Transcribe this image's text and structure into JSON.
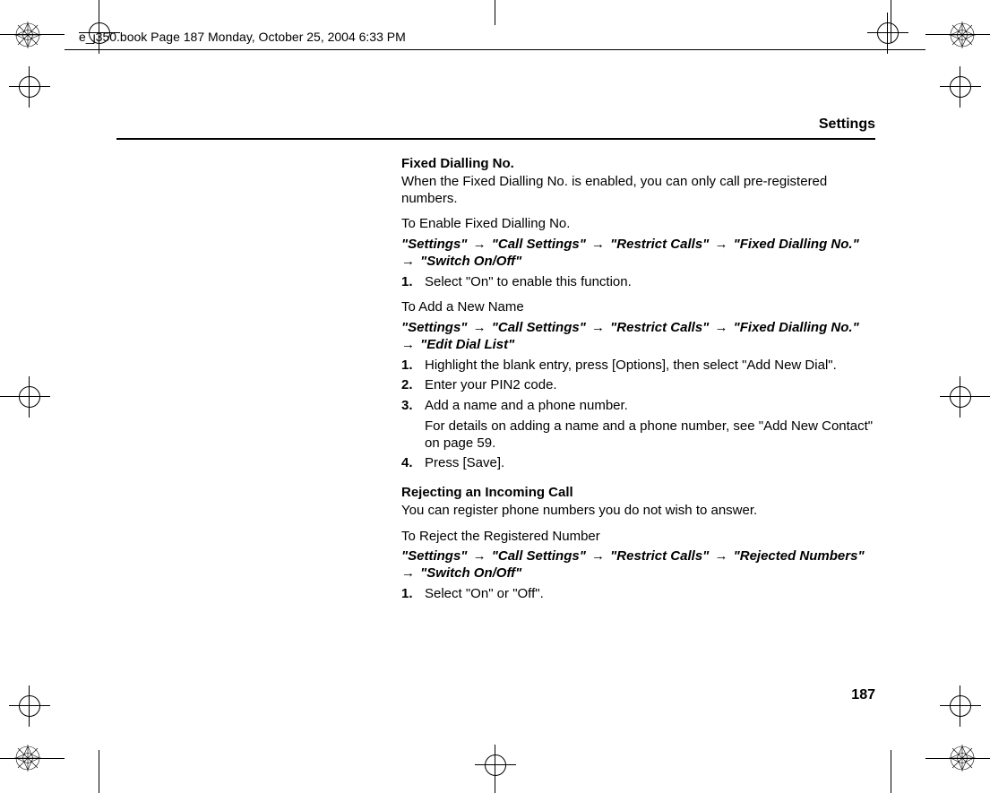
{
  "header": {
    "stamp": "e_j350.book  Page 187  Monday, October 25, 2004  6:33 PM"
  },
  "section_title": "Settings",
  "page_number": "187",
  "body": {
    "fixed_dialling": {
      "heading": "Fixed Dialling No.",
      "desc": "When the Fixed Dialling No. is enabled, you can only call pre-registered numbers.",
      "enable": {
        "title": "To Enable Fixed Dialling No.",
        "path": [
          "\"Settings\"",
          "\"Call Settings\"",
          "\"Restrict Calls\"",
          "\"Fixed Dialling No.\"",
          "\"Switch On/Off\""
        ],
        "steps": [
          "Select \"On\" to enable this function."
        ]
      },
      "add_name": {
        "title": "To Add a New Name",
        "path": [
          "\"Settings\"",
          "\"Call Settings\"",
          "\"Restrict Calls\"",
          "\"Fixed Dialling No.\"",
          "\"Edit Dial List\""
        ],
        "steps": [
          "Highlight the blank entry, press [Options], then select \"Add New Dial\".",
          "Enter your PIN2 code.",
          "Add a name and a phone number."
        ],
        "step3_note": "For details on adding a name and a phone number, see \"Add New Contact\" on page 59.",
        "step4": "Press [Save]."
      }
    },
    "rejecting": {
      "heading": "Rejecting an Incoming Call",
      "desc": "You can register phone numbers you do not wish to answer.",
      "reject": {
        "title": "To Reject the Registered Number",
        "path": [
          "\"Settings\"",
          "\"Call Settings\"",
          "\"Restrict Calls\"",
          "\"Rejected Numbers\"",
          "\"Switch On/Off\""
        ],
        "steps": [
          "Select \"On\" or \"Off\"."
        ]
      }
    }
  }
}
